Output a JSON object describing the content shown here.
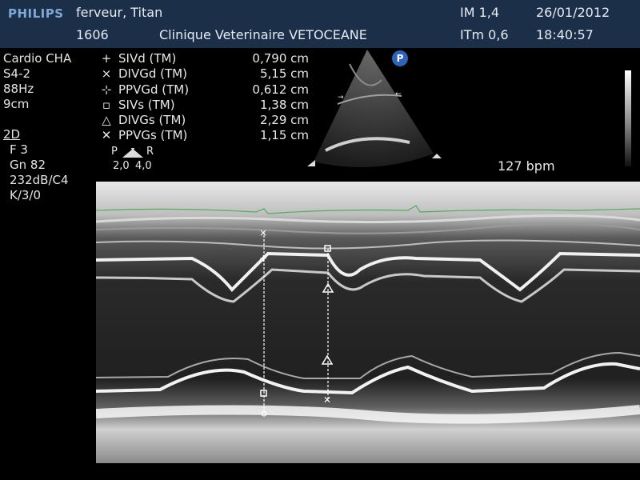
{
  "header": {
    "brand": "PHILIPS",
    "patient_name": "ferveur, Titan",
    "patient_id": "1606",
    "clinic": "Clinique Veterinaire VETOCEANE",
    "im": "IM 1,4",
    "itm": "ITm 0,6",
    "date": "26/01/2012",
    "time": "18:40:57"
  },
  "exam": {
    "preset": "Cardio CHA",
    "probe": "S4-2",
    "frame_rate": "88Hz",
    "depth": "9cm",
    "mode": "2D",
    "focus": "F 3",
    "gain": "Gn 82",
    "dynamic": "232dB/C4",
    "persist": "K/3/0"
  },
  "measurements": [
    {
      "symbol": "+",
      "label": "SIVd (TM)",
      "value": "0,790 cm"
    },
    {
      "symbol": "×",
      "label": "DIVGd (TM)",
      "value": "5,15 cm"
    },
    {
      "symbol": "⊹",
      "label": "PPVGd (TM)",
      "value": "0,612 cm"
    },
    {
      "symbol": "▫",
      "label": "SIVs (TM)",
      "value": "1,38 cm"
    },
    {
      "symbol": "△",
      "label": "DIVGs (TM)",
      "value": "2,29 cm"
    },
    {
      "symbol": "✕",
      "label": "PPVGs (TM)",
      "value": "1,15 cm"
    }
  ],
  "probe_indicator": {
    "p": "P",
    "r": "R",
    "p_val": "2,0",
    "r_val": "4,0"
  },
  "heart_rate": "127 bpm",
  "badge": "P"
}
